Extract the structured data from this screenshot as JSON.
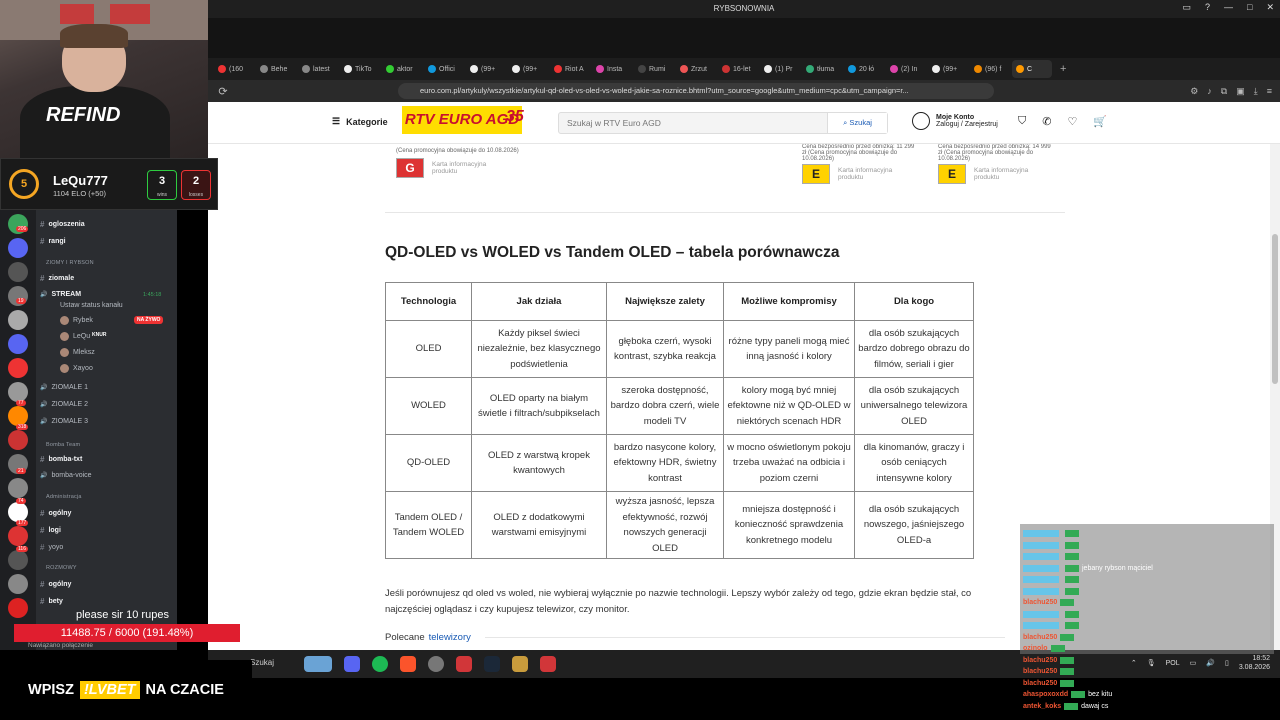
{
  "window": {
    "title": "RYBSONOWNIA",
    "buttons": [
      "▭",
      "?",
      "—",
      "□",
      "✕"
    ]
  },
  "tabs": [
    {
      "label": "(160",
      "color": "#e33"
    },
    {
      "label": "Behe",
      "color": "#888"
    },
    {
      "label": "latest",
      "color": "#888"
    },
    {
      "label": "TikTo",
      "color": "#eee"
    },
    {
      "label": "aktor",
      "color": "#3c3"
    },
    {
      "label": "Offici",
      "color": "#19d"
    },
    {
      "label": "(99+",
      "color": "#eee"
    },
    {
      "label": "(99+",
      "color": "#eee"
    },
    {
      "label": "Riot A",
      "color": "#e33"
    },
    {
      "label": "Insta",
      "color": "#d4a"
    },
    {
      "label": "Rumi",
      "color": "#444"
    },
    {
      "label": "Zrzut",
      "color": "#e55"
    },
    {
      "label": "16-let",
      "color": "#c33"
    },
    {
      "label": "(1) Pr",
      "color": "#eee"
    },
    {
      "label": "tłuma",
      "color": "#3a7"
    },
    {
      "label": "20 łó",
      "color": "#19d"
    },
    {
      "label": "(2) In",
      "color": "#d4a"
    },
    {
      "label": "(99+",
      "color": "#eee"
    },
    {
      "label": "(96) f",
      "color": "#e80"
    },
    {
      "label": "C",
      "color": "#f90",
      "active": true
    }
  ],
  "browser": {
    "url": "euro.com.pl/artykuly/wszystkie/artykul-qd-oled-vs-oled-vs-woled-jakie-sa-roznice.bhtml?utm_source=google&utm_medium=cpc&utm_campaign=r...",
    "reload_icon": "⟳",
    "bookmark_icon": "☆"
  },
  "header": {
    "kategorie": "Kategorie",
    "logo": "RTV EURO AGD",
    "logo_badge": "35",
    "search_placeholder": "Szukaj w RTV Euro AGD",
    "search_button": "Szukaj",
    "account_line1": "Moje Konto",
    "account_line2": "Zaloguj / Zarejestruj"
  },
  "energy_labels": [
    {
      "grade": "G",
      "label": "Karta informacyjna produktu",
      "note": "(Cena promocyjna obowiązuje do 10.08.2026)"
    },
    {
      "grade": "E",
      "label": "Karta informacyjna produktu",
      "note": "Cena bezpośrednio przed obniżką: 11 299 zł (Cena promocyjna obowiązuje do 10.08.2026)"
    },
    {
      "grade": "E",
      "label": "Karta informacyjna produktu",
      "note": "Cena bezpośrednio przed obniżką: 14 999 zł (Cena promocyjna obowiązuje do 10.08.2026)"
    }
  ],
  "article": {
    "heading": "QD-OLED vs WOLED vs Tandem OLED – tabela porównawcza",
    "table": {
      "headers": [
        "Technologia",
        "Jak działa",
        "Największe zalety",
        "Możliwe kompromisy",
        "Dla kogo"
      ],
      "rows": [
        [
          "OLED",
          "Każdy piksel świeci niezależnie, bez klasycznego podświetlenia",
          "głęboka czerń, wysoki kontrast, szybka reakcja",
          "różne typy paneli mogą mieć inną jasność i kolory",
          "dla osób szukających bardzo dobrego obrazu do filmów, seriali i gier"
        ],
        [
          "WOLED",
          "OLED oparty na białym świetle i filtrach/subpikselach",
          "szeroka dostępność, bardzo dobra czerń, wiele modeli TV",
          "kolory mogą być mniej efektowne niż w QD-OLED w niektórych scenach HDR",
          "dla osób szukających uniwersalnego telewizora OLED"
        ],
        [
          "QD-OLED",
          "OLED z warstwą kropek kwantowych",
          "bardzo nasycone kolory, efektowny HDR, świetny kontrast",
          "w mocno oświetlonym pokoju trzeba uważać na odbicia i poziom czerni",
          "dla kinomanów, graczy i osób ceniących intensywne kolory"
        ],
        [
          "Tandem OLED / Tandem WOLED",
          "OLED z dodatkowymi warstwami emisyjnymi",
          "wyższa jasność, lepsza efektywność, rozwój nowszych generacji OLED",
          "mniejsza dostępność i konieczność sprawdzenia konkretnego modelu",
          "dla osób szukających nowszego, jaśniejszego OLED-a"
        ]
      ]
    },
    "paragraph": "Jeśli porównujesz qd oled vs woled, nie wybieraj wyłącznie po nazwie technologii. Lepszy wybór zależy od tego, gdzie ekran będzie stał, co najczęściej oglądasz i czy kupujesz telewizor, czy monitor.",
    "polecane_prefix": "Polecane",
    "polecane_link": "telewizory"
  },
  "taskbar": {
    "search": "Szukaj",
    "lang": "POL",
    "time": "18:52",
    "date": "3.08.2026"
  },
  "elo": {
    "level": "5",
    "name": "LeQu777",
    "elo": "1104 ELO (+50)",
    "wins": "3",
    "wins_label": "wins",
    "losses": "2",
    "losses_label": "losses"
  },
  "discord": {
    "rows": [
      {
        "text": "ogloszenia",
        "type": "channel",
        "bold": true
      },
      {
        "text": "rangi",
        "type": "channel",
        "bold": true
      },
      {
        "text": "ZIOMY I RYBSON",
        "type": "cat"
      },
      {
        "text": "ziomale",
        "type": "channel",
        "bold": true
      },
      {
        "text": "STREAM",
        "type": "voice",
        "bold": true
      },
      {
        "text": "Ustaw status kanału",
        "type": "sub"
      },
      {
        "text": "Rybek",
        "type": "user"
      },
      {
        "text": "LeQu",
        "type": "user"
      },
      {
        "text": "Mleksz",
        "type": "user"
      },
      {
        "text": "Xayoo",
        "type": "user"
      },
      {
        "text": "ZIOMALE 1",
        "type": "voice"
      },
      {
        "text": "ZIOMALE 2",
        "type": "voice"
      },
      {
        "text": "ZIOMALE 3",
        "type": "voice"
      },
      {
        "text": "Bomba Team",
        "type": "cat"
      },
      {
        "text": "bomba-txt",
        "type": "channel",
        "bold": true
      },
      {
        "text": "bomba-voice",
        "type": "voice"
      },
      {
        "text": "Administracja",
        "type": "cat"
      },
      {
        "text": "ogólny",
        "type": "channel",
        "bold": true
      },
      {
        "text": "logi",
        "type": "channel",
        "bold": true
      },
      {
        "text": "yoyo",
        "type": "channel"
      },
      {
        "text": "ROZMOWY",
        "type": "cat"
      },
      {
        "text": "ogólny",
        "type": "channel",
        "bold": true
      },
      {
        "text": "bety",
        "type": "channel",
        "bold": true
      }
    ],
    "live_badge": "NA ŻYWO",
    "timer": "1:45:18",
    "knur": "KNUR",
    "guild_counts": [
      "206",
      "19",
      "77",
      "318",
      "21",
      "74",
      "177",
      "116"
    ]
  },
  "overlay": {
    "rupes": "please sir 10 rupes",
    "progress": "11488.75 / 6000 (191.48%)",
    "notify": "Nawiązano połączenie",
    "vbet_left": "WPISZ",
    "vbet_code": "!LVBET",
    "vbet_right": "NA CZACIE"
  },
  "chat": [
    {
      "user": "",
      "text": ""
    },
    {
      "user": "",
      "text": ""
    },
    {
      "user": "",
      "text": ""
    },
    {
      "user": "",
      "text": "jebany rybson mąciciel"
    },
    {
      "user": "",
      "text": ""
    },
    {
      "user": "",
      "text": ""
    },
    {
      "user": "blachu250",
      "text": ""
    },
    {
      "user": "",
      "text": ""
    },
    {
      "user": "",
      "text": ""
    },
    {
      "user": "blachu250",
      "text": ""
    },
    {
      "user": "ozinolo",
      "text": ""
    },
    {
      "user": "blachu250",
      "text": ""
    },
    {
      "user": "blachu250",
      "text": ""
    },
    {
      "user": "blachu250",
      "text": ""
    },
    {
      "user": "ahaspoxoxdd",
      "text": "bez kitu"
    },
    {
      "user": "antek_koks",
      "text": "dawaj cs"
    }
  ]
}
